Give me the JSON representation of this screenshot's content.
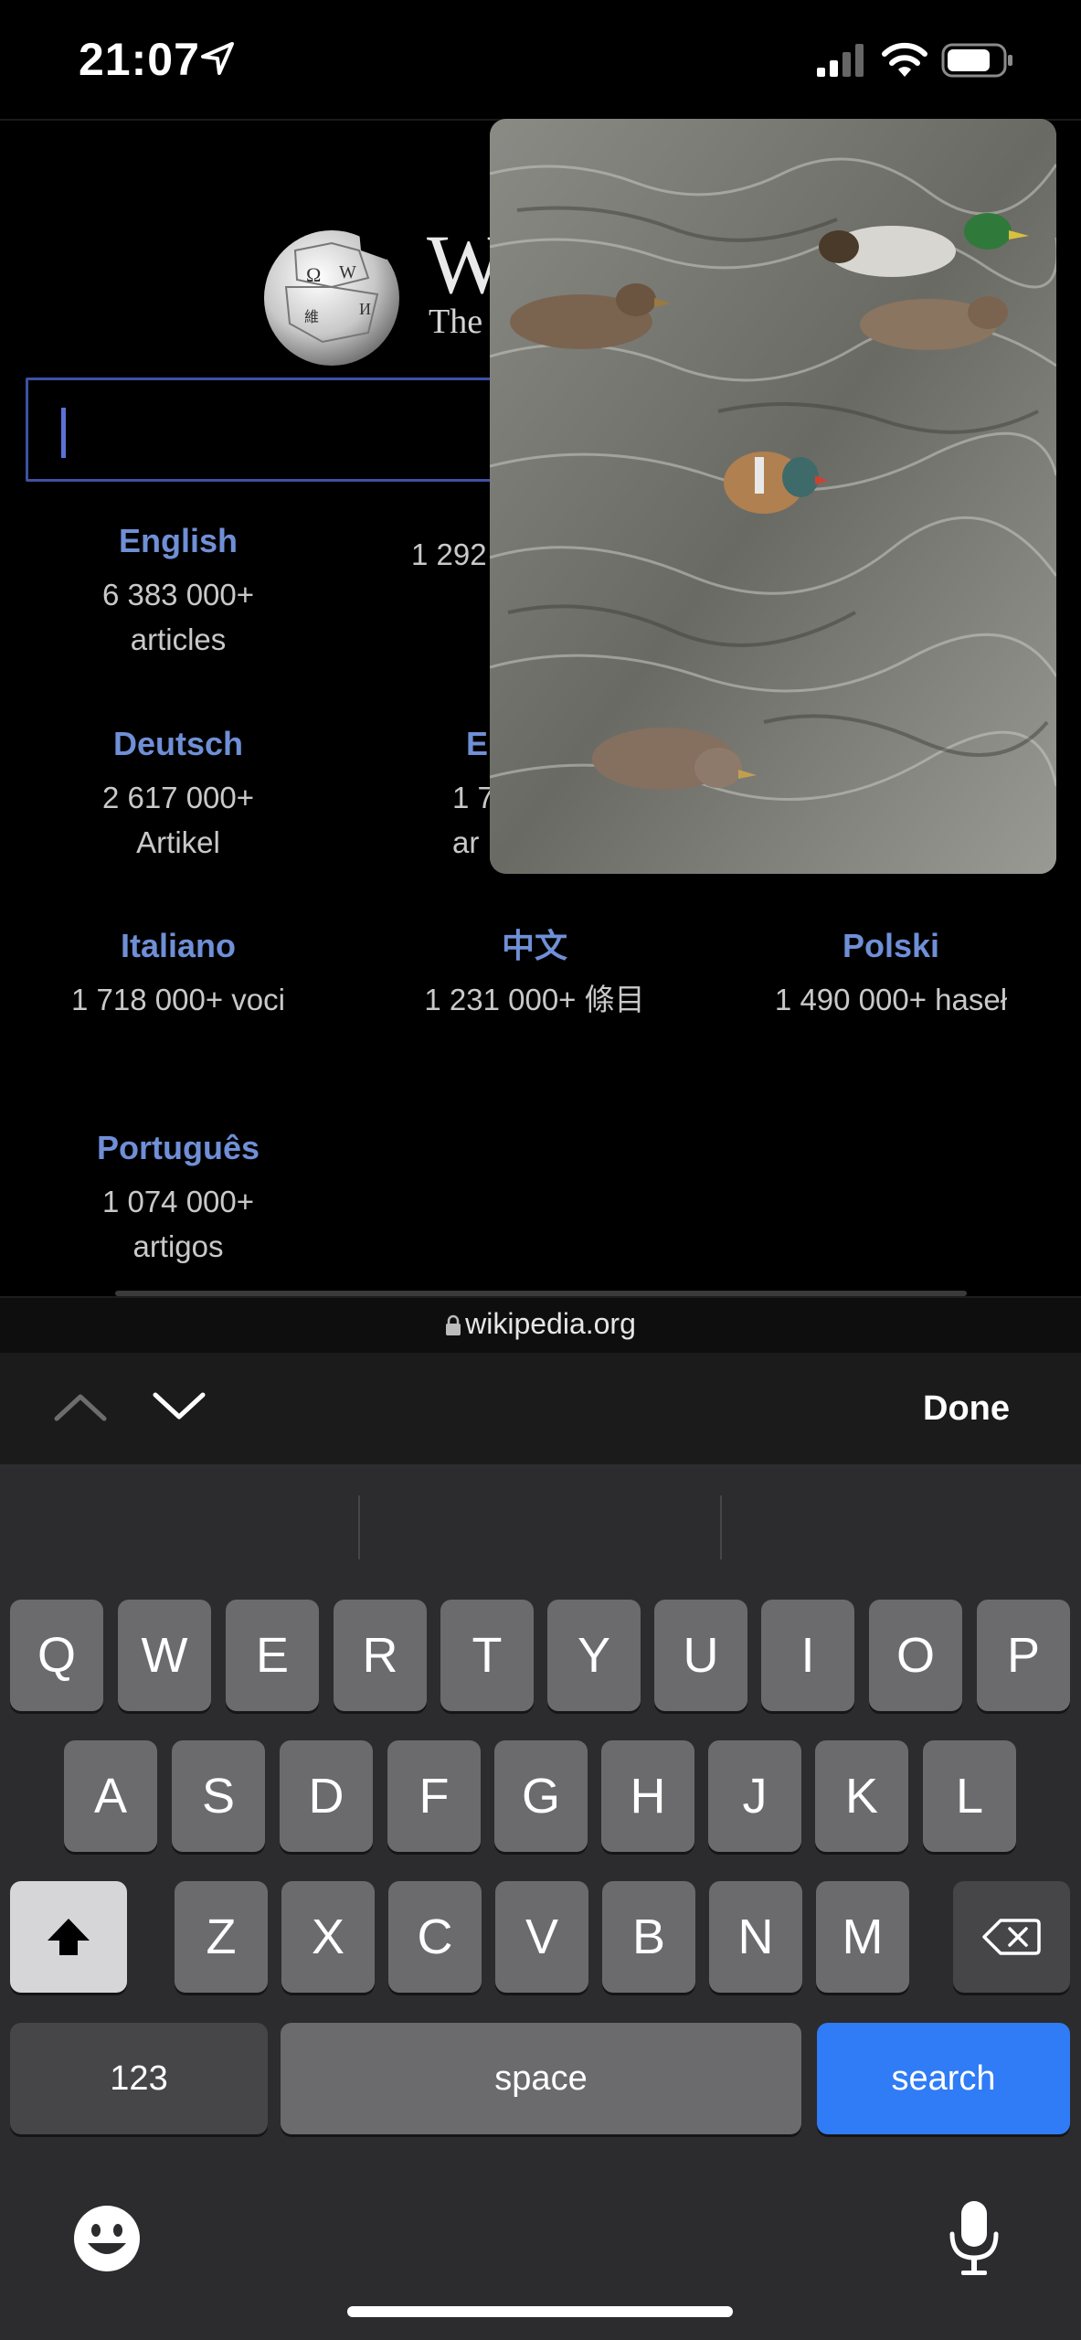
{
  "status_bar": {
    "time": "21:07"
  },
  "wiki": {
    "wordmark": "W",
    "tagline": "The",
    "languages": [
      {
        "name": "English",
        "count": "6 383 000+\narticles"
      },
      {
        "name": "",
        "count": "1 292"
      },
      {
        "name": "Deutsch",
        "count": "2 617 000+\nArtikel"
      },
      {
        "name": "E",
        "count": "1 7\nar"
      },
      {
        "name": "Italiano",
        "count": "1 718 000+ voci"
      },
      {
        "name": "中文",
        "count": "1 231 000+ 條目"
      },
      {
        "name": "Polski",
        "count": "1 490 000+ haseł"
      },
      {
        "name": "Português",
        "count": "1 074 000+\nartigos"
      }
    ]
  },
  "url_bar": {
    "domain": "wikipedia.org"
  },
  "toolbar": {
    "done_label": "Done"
  },
  "keyboard": {
    "row1": [
      "Q",
      "W",
      "E",
      "R",
      "T",
      "Y",
      "U",
      "I",
      "O",
      "P"
    ],
    "row2": [
      "A",
      "S",
      "D",
      "F",
      "G",
      "H",
      "J",
      "K",
      "L"
    ],
    "row3": [
      "Z",
      "X",
      "C",
      "V",
      "B",
      "N",
      "M"
    ],
    "numbers_label": "123",
    "space_label": "space",
    "search_label": "search"
  },
  "icons": {
    "location": "location-arrow-icon",
    "signal": "cellular-signal-icon",
    "wifi": "wifi-icon",
    "battery": "battery-icon",
    "globe": "wikipedia-globe-icon",
    "lock": "lock-icon",
    "shift": "shift-icon",
    "backspace": "backspace-icon",
    "emoji": "emoji-icon",
    "mic": "microphone-icon",
    "prev": "chevron-up-icon",
    "next": "chevron-down-icon"
  },
  "colors": {
    "link": "#6f8fd6",
    "search_key": "#2f7cf6",
    "keyboard_bg": "#2c2c2e"
  }
}
